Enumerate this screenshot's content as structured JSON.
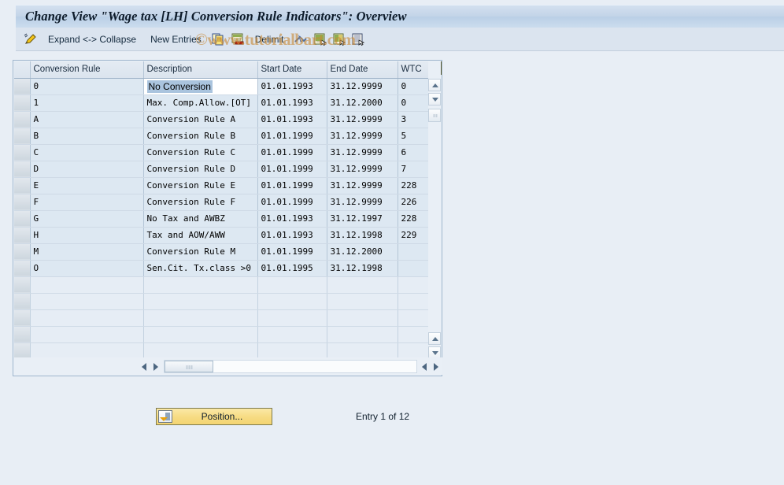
{
  "window": {
    "title": "Change View \"Wage tax [LH] Conversion Rule Indicators\": Overview"
  },
  "watermark": {
    "text": "©www.tutorialbart.com"
  },
  "toolbar": {
    "edit_icon": "pencil-icon",
    "expand_collapse_label": "Expand <-> Collapse",
    "new_entries_label": "New Entries",
    "copy_icon": "copy-as-icon",
    "delete_icon": "delete-row-icon",
    "delimit_label": "Delimit",
    "undo_icon": "undo-icon",
    "prev_entry_icon": "previous-entry-icon",
    "next_entry_icon": "next-entry-icon",
    "select_all_icon": "select-layout-icon"
  },
  "table": {
    "config_icon": "grid-settings-icon",
    "columns": [
      "Conversion Rule",
      "Description",
      "Start Date",
      "End Date",
      "WTC"
    ],
    "selected_cell": "No Conversion",
    "rows": [
      {
        "rule": "0",
        "description": "No Conversion",
        "start": "01.01.1993",
        "end": "31.12.9999",
        "wtc": "0"
      },
      {
        "rule": "1",
        "description": "Max. Comp.Allow.[OT]",
        "start": "01.01.1993",
        "end": "31.12.2000",
        "wtc": "0"
      },
      {
        "rule": "A",
        "description": "Conversion Rule A",
        "start": "01.01.1993",
        "end": "31.12.9999",
        "wtc": "3"
      },
      {
        "rule": "B",
        "description": "Conversion Rule B",
        "start": "01.01.1999",
        "end": "31.12.9999",
        "wtc": "5"
      },
      {
        "rule": "C",
        "description": "Conversion Rule C",
        "start": "01.01.1999",
        "end": "31.12.9999",
        "wtc": "6"
      },
      {
        "rule": "D",
        "description": "Conversion Rule D",
        "start": "01.01.1999",
        "end": "31.12.9999",
        "wtc": "7"
      },
      {
        "rule": "E",
        "description": "Conversion Rule E",
        "start": "01.01.1999",
        "end": "31.12.9999",
        "wtc": "228"
      },
      {
        "rule": "F",
        "description": "Conversion Rule F",
        "start": "01.01.1999",
        "end": "31.12.9999",
        "wtc": "226"
      },
      {
        "rule": "G",
        "description": "No Tax and AWBZ",
        "start": "01.01.1993",
        "end": "31.12.1997",
        "wtc": "228"
      },
      {
        "rule": "H",
        "description": "Tax and AOW/AWW",
        "start": "01.01.1993",
        "end": "31.12.1998",
        "wtc": "229"
      },
      {
        "rule": "M",
        "description": "Conversion Rule M",
        "start": "01.01.1999",
        "end": "31.12.2000",
        "wtc": ""
      },
      {
        "rule": "O",
        "description": "Sen.Cit. Tx.class >0",
        "start": "01.01.1995",
        "end": "31.12.1998",
        "wtc": ""
      }
    ],
    "empty_row_count": 6
  },
  "footer": {
    "position_label": "Position...",
    "entry_count": "Entry 1 of 12"
  },
  "colors": {
    "accent": "#aac4de",
    "title_bar": "#c3d4e8",
    "page_background": "#e8eef5",
    "button_yellow": "#f7dc85",
    "watermark": "#c98a38"
  }
}
